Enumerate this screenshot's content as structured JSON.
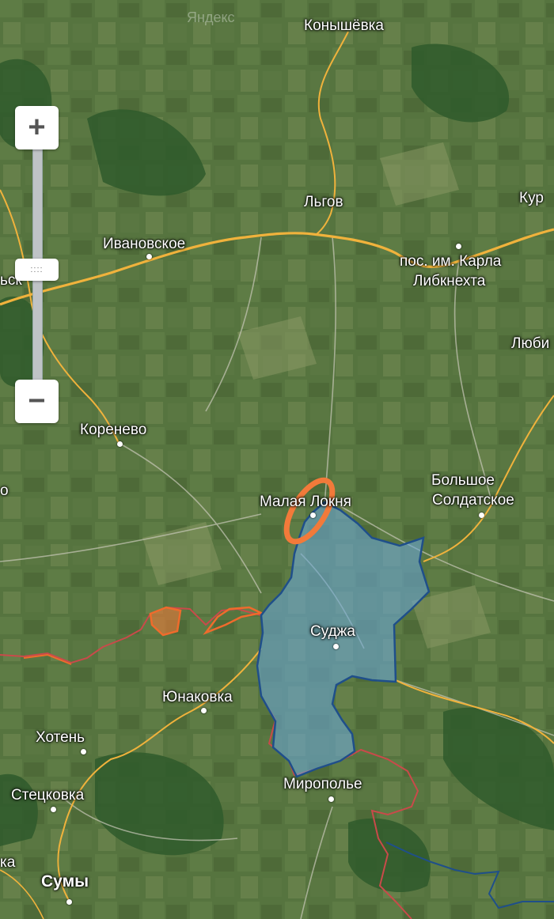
{
  "map": {
    "watermark": "Яндекс",
    "places": {
      "konyshevka": "Конышёвка",
      "lgov": "Льгов",
      "kur": "Кур",
      "ivanovskoe": "Ивановское",
      "karla_1": "пос. им. Карла",
      "karla_2": "Либкнехта",
      "sk": "ьск",
      "lyubi": "Люби",
      "korenevo": "Коренево",
      "o": "о",
      "malaya_loknya": "Малая Локня",
      "bolshoe_1": "Большое",
      "bolshoe_2": "Солдатское",
      "sudzha": "Суджа",
      "yunakovka": "Юнаковка",
      "khoten": "Хотень",
      "mirop": "Миропольe",
      "stetskovka": "Стецковка",
      "ka": "ка",
      "sumy": "Сумы"
    },
    "highlight_color": "#f27a3a",
    "region_fill": "#6aa6d4",
    "region_stroke": "#1f4f8a",
    "border_color": "#c94a4a",
    "road_color": "#f0b23c"
  },
  "controls": {
    "zoom_in": "+",
    "zoom_out": "−",
    "handle": "::::"
  }
}
